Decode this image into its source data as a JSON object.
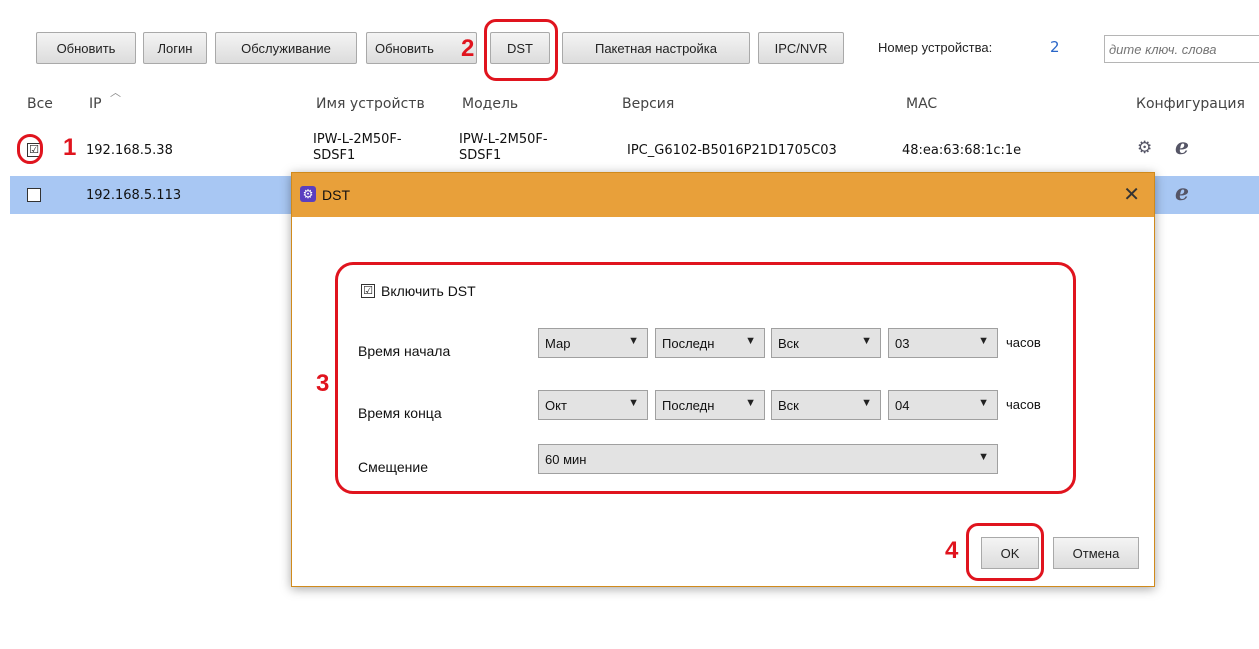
{
  "toolbar": {
    "buttons": [
      "Обновить",
      "Логин",
      "Обслуживание",
      "Обновить",
      "DST",
      "Пакетная настройка",
      "IPC/NVR"
    ],
    "device_count_label": "Номер устройства:",
    "device_count": "2",
    "search_placeholder": "дите ключ. слова"
  },
  "table": {
    "headers": [
      "Все",
      "IP",
      "Имя устройств",
      "Модель",
      "Версия",
      "MAC",
      "Конфигурация"
    ],
    "rows": [
      {
        "checked": "☑",
        "ip": "192.168.5.38",
        "name1": "IPW-L-2M50F-",
        "name2": "SDSF1",
        "model1": "IPW-L-2M50F-",
        "model2": "SDSF1",
        "version": "IPC_G6102-B5016P21D1705C03",
        "mac": "48:ea:63:68:1c:1e"
      },
      {
        "checked": "",
        "ip": "192.168.5.113"
      }
    ],
    "config_icons": [
      "gear-icon",
      "ie-icon"
    ]
  },
  "dialog": {
    "title": "DST",
    "close": "✕",
    "enable_label": "Включить DST",
    "enable_checked": "☑",
    "start_label": "Время начала",
    "end_label": "Время конца",
    "offset_label": "Смещение",
    "start": {
      "month": "Мар",
      "week": "Последн",
      "day": "Вск",
      "hour": "03",
      "unit": "часов"
    },
    "end": {
      "month": "Окт",
      "week": "Последн",
      "day": "Вск",
      "hour": "04",
      "unit": "часов"
    },
    "offset": "60 мин",
    "ok": "OK",
    "cancel": "Отмена"
  },
  "annotations": {
    "n1": "1",
    "n2": "2",
    "n3": "3",
    "n4": "4",
    "color": "#e0141e"
  }
}
